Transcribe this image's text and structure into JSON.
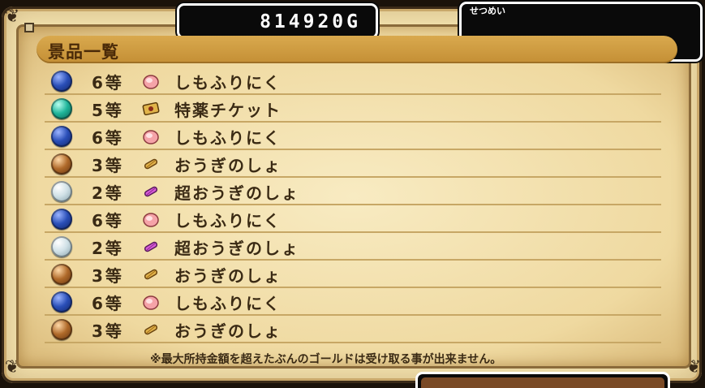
{
  "gold": {
    "amount": "814920G"
  },
  "description": {
    "label": "せつめい"
  },
  "prize_list": {
    "title": "景品一覧",
    "rows": [
      {
        "orb": "blue",
        "rank": "6等",
        "icon": "meat-icon",
        "name": "しもふりにく"
      },
      {
        "orb": "teal",
        "rank": "5等",
        "icon": "ticket-icon",
        "name": "特薬チケット"
      },
      {
        "orb": "blue",
        "rank": "6等",
        "icon": "meat-icon",
        "name": "しもふりにく"
      },
      {
        "orb": "bronze",
        "rank": "3等",
        "icon": "scroll-icon",
        "name": "おうぎのしょ"
      },
      {
        "orb": "silver",
        "rank": "2等",
        "icon": "purple-scroll-icon",
        "name": "超おうぎのしょ"
      },
      {
        "orb": "blue",
        "rank": "6等",
        "icon": "meat-icon",
        "name": "しもふりにく"
      },
      {
        "orb": "silver",
        "rank": "2等",
        "icon": "purple-scroll-icon",
        "name": "超おうぎのしょ"
      },
      {
        "orb": "bronze",
        "rank": "3等",
        "icon": "scroll-icon",
        "name": "おうぎのしょ"
      },
      {
        "orb": "blue",
        "rank": "6等",
        "icon": "meat-icon",
        "name": "しもふりにく"
      },
      {
        "orb": "bronze",
        "rank": "3等",
        "icon": "scroll-icon",
        "name": "おうぎのしょ"
      }
    ]
  },
  "footer_note": "※最大所持金額を超えたぶんのゴールドは受け取る事が出来ません。",
  "colors": {
    "orb_blue": "#2a4fb8",
    "orb_teal": "#1fb59a",
    "orb_bronze": "#b06a2a",
    "orb_silver": "#cfe0e6",
    "accent_title_bar": "#c9963c"
  }
}
